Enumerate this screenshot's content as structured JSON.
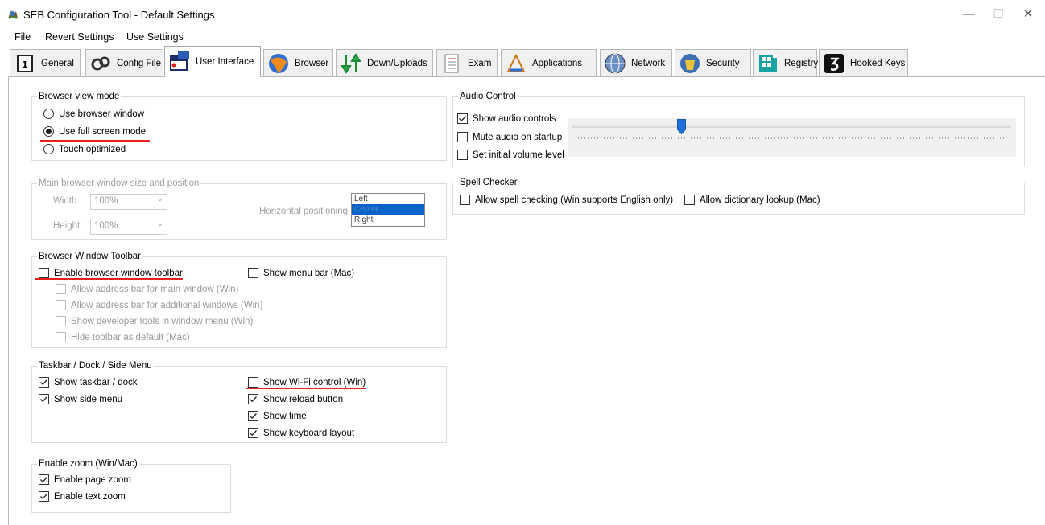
{
  "window": {
    "title": "SEB Configuration Tool - Default Settings",
    "minimize": "—",
    "maximize": "☐",
    "close": "✕"
  },
  "menu": [
    "File",
    "Revert Settings",
    "Use Settings"
  ],
  "tabs": [
    {
      "label": "General",
      "icon": "general-icon"
    },
    {
      "label": "Config File",
      "icon": "config-file-icon"
    },
    {
      "label": "User Interface",
      "icon": "user-interface-icon",
      "active": true
    },
    {
      "label": "Browser",
      "icon": "browser-icon"
    },
    {
      "label": "Down/Uploads",
      "icon": "down-uploads-icon"
    },
    {
      "label": "Exam",
      "icon": "exam-icon"
    },
    {
      "label": "Applications",
      "icon": "applications-icon"
    },
    {
      "label": "Network",
      "icon": "network-icon"
    },
    {
      "label": "Security",
      "icon": "security-icon"
    },
    {
      "label": "Registry",
      "icon": "registry-icon"
    },
    {
      "label": "Hooked Keys",
      "icon": "hooked-keys-icon"
    }
  ],
  "browser_view_mode": {
    "title": "Browser view mode",
    "options": [
      "Use browser window",
      "Use full screen mode",
      "Touch optimized"
    ],
    "selected": "Use full screen mode"
  },
  "main_window": {
    "title": "Main browser window size and position",
    "width_label": "Width",
    "width_value": "100%",
    "height_label": "Height",
    "height_value": "100%",
    "hpos_label": "Horizontal positioning",
    "hpos_options": [
      "Left",
      "Center",
      "Right"
    ],
    "hpos_selected": "Center"
  },
  "toolbar": {
    "title": "Browser Window Toolbar",
    "enable": {
      "label": "Enable browser window toolbar",
      "checked": false
    },
    "menu_bar": {
      "label": "Show menu bar (Mac)",
      "checked": false
    },
    "sub": [
      "Allow address bar for main window (Win)",
      "Allow address bar for additional windows (Win)",
      "Show developer tools in window menu (Win)",
      "Hide toolbar as default (Mac)"
    ]
  },
  "taskbar": {
    "title": "Taskbar / Dock / Side Menu",
    "show_taskbar": {
      "label": "Show taskbar / dock",
      "checked": true
    },
    "show_side_menu": {
      "label": "Show side menu",
      "checked": true
    },
    "wifi": {
      "label": "Show Wi-Fi control (Win)",
      "checked": false
    },
    "reload": {
      "label": "Show reload button",
      "checked": true
    },
    "time": {
      "label": "Show time",
      "checked": true
    },
    "keyboard": {
      "label": "Show keyboard layout",
      "checked": true
    }
  },
  "zoom": {
    "title": "Enable zoom (Win/Mac)",
    "page": {
      "label": "Enable page zoom",
      "checked": true
    },
    "text": {
      "label": "Enable text zoom",
      "checked": true
    }
  },
  "audio": {
    "title": "Audio Control",
    "show_controls": {
      "label": "Show audio controls",
      "checked": true
    },
    "mute": {
      "label": "Mute audio on startup",
      "checked": false
    },
    "initial": {
      "label": "Set initial volume level",
      "checked": false
    },
    "volume_fraction": 0.25
  },
  "spell": {
    "title": "Spell Checker",
    "allow_spell": {
      "label": "Allow spell checking (Win supports English only)",
      "checked": false
    },
    "dict": {
      "label": "Allow dictionary lookup (Mac)",
      "checked": false
    }
  },
  "colors": {
    "highlight_underline": "#e8201f",
    "selection": "#0a64c7"
  }
}
